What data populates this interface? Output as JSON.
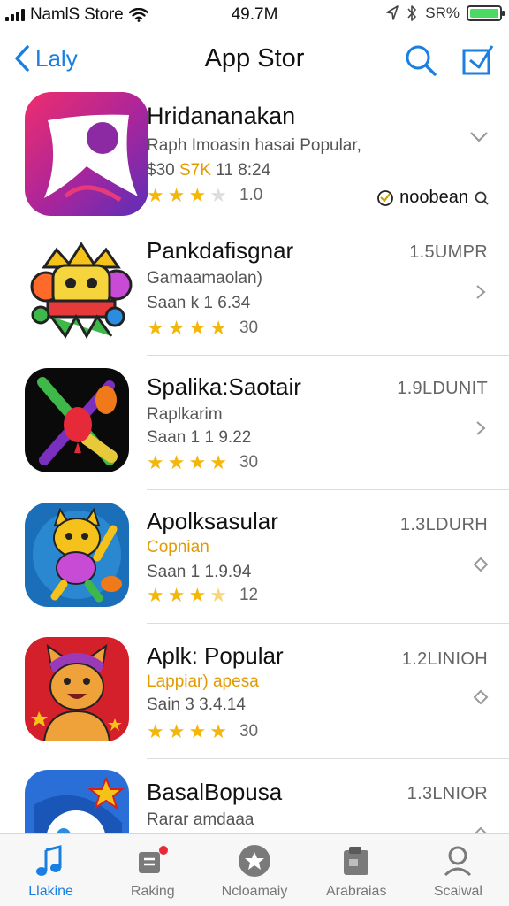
{
  "status_bar": {
    "carrier": "NamlS Store",
    "time": "49.7M",
    "battery_text": "SR%",
    "battery_level": 1.0
  },
  "nav": {
    "back_label": "Laly",
    "title": "App Stor"
  },
  "apps": [
    {
      "name": "Hridananakan",
      "subtitle": "Raph Imoasin hasai Popular,",
      "meta_prefix": "$30 ",
      "meta_highlight": "S7K",
      "meta_suffix": " 11 8:24",
      "rating": 3,
      "rating_count": "1.0",
      "size": "",
      "badge_text": "noobean"
    },
    {
      "name": "Pankdafisgnar",
      "subtitle": "Gamaamaolan)",
      "meta": "Saan  k 1 6.34",
      "rating": 4,
      "rating_count": "30",
      "size": "1.5UMPR"
    },
    {
      "name": "Spalika:Saotair",
      "subtitle": "Raplkarim",
      "meta": "Saan 1 1 9.22",
      "rating": 4,
      "rating_count": "30",
      "size": "1.9LDUNIT"
    },
    {
      "name": "Apolksasular",
      "subtitle": "Copnian",
      "meta": "Saan 1 1.9.94",
      "rating": 3.5,
      "rating_count": "12",
      "size": "1.3LDURH"
    },
    {
      "name": "Aplk: Popular",
      "subtitle": "Lappiar) apesa",
      "meta": "Sain 3 3.4.14",
      "rating": 4,
      "rating_count": "30",
      "size": "1.2LINIOH"
    },
    {
      "name": "BasalBopusa",
      "subtitle": "Rarar amdaaa",
      "meta": "",
      "rating": 0,
      "rating_count": "",
      "size": "1.3LNIOR"
    }
  ],
  "tabs": [
    {
      "label": "Llakine",
      "icon": "music-note-icon",
      "active": true
    },
    {
      "label": "Raking",
      "icon": "ranking-icon",
      "active": false
    },
    {
      "label": "Ncloamaiy",
      "icon": "featured-star-icon",
      "active": false
    },
    {
      "label": "Arabraias",
      "icon": "apps-icon",
      "active": false
    },
    {
      "label": "Scaiwal",
      "icon": "search-person-icon",
      "active": false
    }
  ],
  "colors": {
    "accent": "#1a7fe0",
    "star": "#f5b60a",
    "highlight_orange": "#e39a00",
    "battery_green": "#4cd964"
  }
}
